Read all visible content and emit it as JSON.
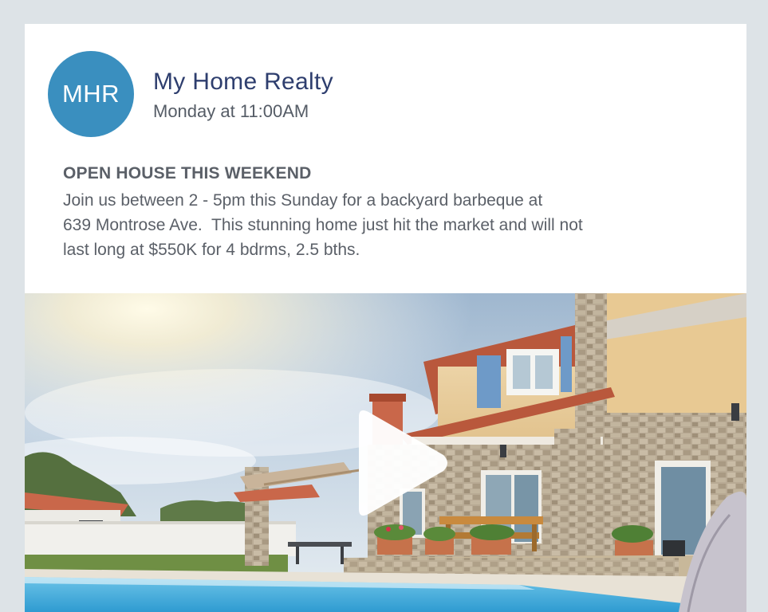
{
  "post": {
    "avatar_text": "MHR",
    "page_name": "My Home Realty",
    "timestamp": "Monday at 11:00AM",
    "heading": "OPEN HOUSE THIS WEEKEND",
    "body_lines": [
      "Join us between 2 - 5pm this Sunday for a backyard barbeque at",
      "639 Montrose Ave.  This stunning home just hit the market and will not",
      "last long at $550K for 4 bdrms, 2.5 bths."
    ]
  },
  "media": {
    "type": "video",
    "play_icon": "play-icon",
    "description_icon": "house-with-pool-photo"
  },
  "colors": {
    "avatar_bg": "#3a8fbf",
    "page_name": "#2e3e6e",
    "text": "#5b6068",
    "frame_bg": "#dde3e7"
  }
}
